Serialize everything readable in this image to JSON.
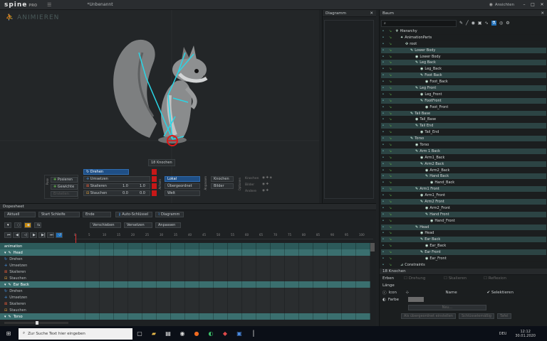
{
  "app": {
    "logo": "spine",
    "logo_suffix": "PRO",
    "document_title": "*Unbenannt",
    "mode": "ANIMIEREN"
  },
  "views_label": "Ansichten",
  "viewport": {
    "bones_count": "18 Knochen"
  },
  "tools": {
    "transform": [
      {
        "label": "Drehen",
        "value": "",
        "active": true
      },
      {
        "label": "Umsetzen",
        "value": "",
        "active": false
      },
      {
        "label": "Skalieren",
        "x": "1.0",
        "y": "1.0",
        "active": false
      },
      {
        "label": "Stauchen",
        "x": "0.0",
        "y": "0.0",
        "active": false
      }
    ],
    "pose": [
      "Posieren",
      "Gewichte",
      "Erstellen"
    ],
    "pose_group": "Pose",
    "axes": [
      "Lokal",
      "Übergeordnet",
      "Welt"
    ],
    "axes_group": "Achsen",
    "compensate_group": "Anpassen",
    "compensate": [
      "Knochen",
      "Bilder"
    ],
    "options_group": "Optionen",
    "options": [
      "Knochen",
      "Bilder",
      "Andere"
    ]
  },
  "dopesheet": {
    "title": "Dopesheet",
    "animation_select": "Aktuell",
    "start_loop": "Start Schleife",
    "end": "Ende",
    "auto_key": "Auto-Schlüssel",
    "graph": "Diagramm",
    "move": "Verschieben",
    "offset": "Versetzen",
    "adjust": "Anpassen",
    "ruler": [
      "0",
      "5",
      "10",
      "15",
      "20",
      "25",
      "30",
      "35",
      "40",
      "45",
      "50",
      "55",
      "60",
      "65",
      "70",
      "75",
      "80",
      "85",
      "90",
      "95",
      "100"
    ],
    "tracks": [
      {
        "label": "animation",
        "type": "root"
      },
      {
        "label": "Head",
        "type": "head"
      },
      {
        "label": "Drehen",
        "type": "sub",
        "icon": "rotate-icon"
      },
      {
        "label": "Umsetzen",
        "type": "sub",
        "icon": "translate-icon"
      },
      {
        "label": "Skalieren",
        "type": "sub",
        "icon": "scale-icon"
      },
      {
        "label": "Stauchen",
        "type": "sub",
        "icon": "shear-icon"
      },
      {
        "label": "Ear Back",
        "type": "head"
      },
      {
        "label": "Drehen",
        "type": "sub",
        "icon": "rotate-icon"
      },
      {
        "label": "Umsetzen",
        "type": "sub",
        "icon": "translate-icon"
      },
      {
        "label": "Skalieren",
        "type": "sub",
        "icon": "scale-icon"
      },
      {
        "label": "Stauchen",
        "type": "sub",
        "icon": "shear-icon"
      },
      {
        "label": "Torso",
        "type": "head"
      }
    ]
  },
  "graph_panel": {
    "title": "Diagramm"
  },
  "tree_panel": {
    "title": "Baum",
    "rows": [
      {
        "label": "Hierarchy",
        "indent": 0,
        "icon": "hierarchy-icon",
        "grp": false
      },
      {
        "label": "AnimationParts",
        "indent": 1,
        "icon": "skeleton-icon",
        "grp": false
      },
      {
        "label": "root",
        "indent": 2,
        "icon": "root-icon",
        "grp": false
      },
      {
        "label": "Lower Body",
        "indent": 3,
        "icon": "bone-icon",
        "grp": true
      },
      {
        "label": "Lower Body",
        "indent": 4,
        "icon": "slot-icon",
        "grp": false
      },
      {
        "label": "Leg Back",
        "indent": 4,
        "icon": "bone-icon",
        "grp": true
      },
      {
        "label": "Leg_Back",
        "indent": 5,
        "icon": "slot-icon",
        "grp": false
      },
      {
        "label": "Foot Back",
        "indent": 5,
        "icon": "bone-icon",
        "grp": true
      },
      {
        "label": "Foot_Back",
        "indent": 6,
        "icon": "slot-icon",
        "grp": false
      },
      {
        "label": "Leg Front",
        "indent": 4,
        "icon": "bone-icon",
        "grp": true
      },
      {
        "label": "Leg_Front",
        "indent": 5,
        "icon": "slot-icon",
        "grp": false
      },
      {
        "label": "FootFront",
        "indent": 5,
        "icon": "bone-icon",
        "grp": true
      },
      {
        "label": "Foot_Front",
        "indent": 6,
        "icon": "slot-icon",
        "grp": false
      },
      {
        "label": "Tail Base",
        "indent": 3,
        "icon": "bone-icon",
        "grp": true
      },
      {
        "label": "Tail_Base",
        "indent": 4,
        "icon": "slot-icon",
        "grp": false
      },
      {
        "label": "Tail End",
        "indent": 4,
        "icon": "bone-icon",
        "grp": true
      },
      {
        "label": "Tail_End",
        "indent": 5,
        "icon": "slot-icon",
        "grp": false
      },
      {
        "label": "Torso",
        "indent": 3,
        "icon": "bone-icon",
        "grp": true
      },
      {
        "label": "Torso",
        "indent": 4,
        "icon": "slot-icon",
        "grp": false
      },
      {
        "label": "Arm 1 Back",
        "indent": 4,
        "icon": "bone-icon",
        "grp": true
      },
      {
        "label": "Arm1_Back",
        "indent": 5,
        "icon": "slot-icon",
        "grp": false
      },
      {
        "label": "Arm2 Back",
        "indent": 5,
        "icon": "bone-icon",
        "grp": true
      },
      {
        "label": "Arm2_Back",
        "indent": 6,
        "icon": "slot-icon",
        "grp": false
      },
      {
        "label": "Hand Back",
        "indent": 6,
        "icon": "bone-icon",
        "grp": true
      },
      {
        "label": "Hand_Back",
        "indent": 7,
        "icon": "slot-icon",
        "grp": false
      },
      {
        "label": "Arm1 Front",
        "indent": 4,
        "icon": "bone-icon",
        "grp": true
      },
      {
        "label": "Arm1_Front",
        "indent": 5,
        "icon": "slot-icon",
        "grp": false
      },
      {
        "label": "Arm2 Front",
        "indent": 5,
        "icon": "bone-icon",
        "grp": true
      },
      {
        "label": "Arm2_Front",
        "indent": 6,
        "icon": "slot-icon",
        "grp": false
      },
      {
        "label": "Hand Front",
        "indent": 6,
        "icon": "bone-icon",
        "grp": true
      },
      {
        "label": "Hand_Front",
        "indent": 7,
        "icon": "slot-icon",
        "grp": false
      },
      {
        "label": "Head",
        "indent": 4,
        "icon": "bone-icon",
        "grp": true
      },
      {
        "label": "Head",
        "indent": 5,
        "icon": "slot-icon",
        "grp": false
      },
      {
        "label": "Ear Back",
        "indent": 5,
        "icon": "bone-icon",
        "grp": true
      },
      {
        "label": "Ear_Back",
        "indent": 6,
        "icon": "slot-icon",
        "grp": false
      },
      {
        "label": "Ear Front",
        "indent": 5,
        "icon": "bone-icon",
        "grp": true
      },
      {
        "label": "Ear_Front",
        "indent": 6,
        "icon": "slot-icon",
        "grp": false
      },
      {
        "label": "Constraints",
        "indent": 1,
        "icon": "constraint-icon",
        "grp": false
      }
    ]
  },
  "properties": {
    "title": "18 Knochen",
    "inherit": "Erben",
    "inherit_opts": [
      "Drehung",
      "Skalieren",
      "Reflexion"
    ],
    "length": "Länge",
    "icon_label": "Icon",
    "name_label": "Name",
    "selected_label": "Selektieren",
    "color_label": "Farbe",
    "new_btn": "Neu...",
    "footer": [
      "Als übergeordnet einstellen",
      "Schlüsselemäßig",
      "Tafel"
    ]
  },
  "taskbar": {
    "search_placeholder": "Zur Suche Text hier eingeben",
    "lang": "DEU",
    "time": "12:12",
    "date": "30.01.2020"
  },
  "colors": {
    "accent": "#1f6fb8",
    "teal": "#3a7a7a",
    "cyan_bone": "#2ad6e6",
    "red_tool": "#e01818"
  }
}
